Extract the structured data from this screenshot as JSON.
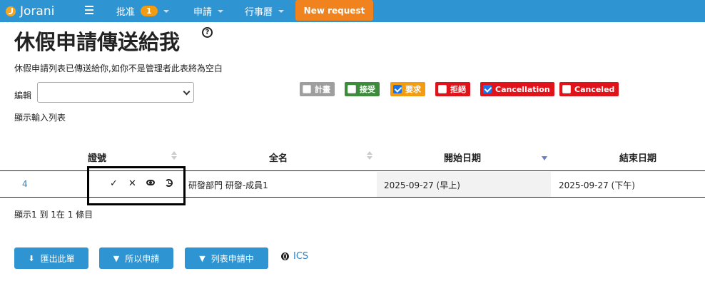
{
  "navbar": {
    "brand": "Jorani",
    "approval_label": "批准",
    "approval_count": "1",
    "requests_label": "申請",
    "calendar_label": "行事曆",
    "new_request_label": "New request",
    "bg_color": "#2f95d2",
    "accent_color": "#f0831e"
  },
  "page": {
    "title": "休假申請傳送給我",
    "help_glyph": "?",
    "subtitle": "休假申請列表已傳送給你,如你不是管理者此表將為空白",
    "edit_label": "編輯",
    "show_list_label": "顯示輸入列表"
  },
  "status_filters": [
    {
      "label": "計畫",
      "checked": false,
      "color": "#9e9e9e"
    },
    {
      "label": "接受",
      "checked": false,
      "color": "#3c8c3c"
    },
    {
      "label": "要求",
      "checked": true,
      "color": "#f39c12"
    },
    {
      "label": "拒絕",
      "checked": false,
      "color": "#e0131a"
    },
    {
      "label": "Cancellation",
      "checked": true,
      "color": "#e0131a"
    },
    {
      "label": "Canceled",
      "checked": false,
      "color": "#e0131a"
    }
  ],
  "table": {
    "headers": [
      "證號",
      "全名",
      "開始日期",
      "結束日期"
    ],
    "rows": [
      {
        "id": "4",
        "fullname": "研發部門 研發-成員1",
        "start": "2025-09-27 (早上)",
        "end": "2025-09-27 (下午)"
      }
    ],
    "row_actions": {
      "accept": "✓",
      "reject": "✕"
    },
    "footer": "顯示1 到 1在 1 條目"
  },
  "buttons": {
    "export": "匯出此單",
    "all_requests": "所以申請",
    "list_requests": "列表申請中",
    "ics": "ICS"
  }
}
